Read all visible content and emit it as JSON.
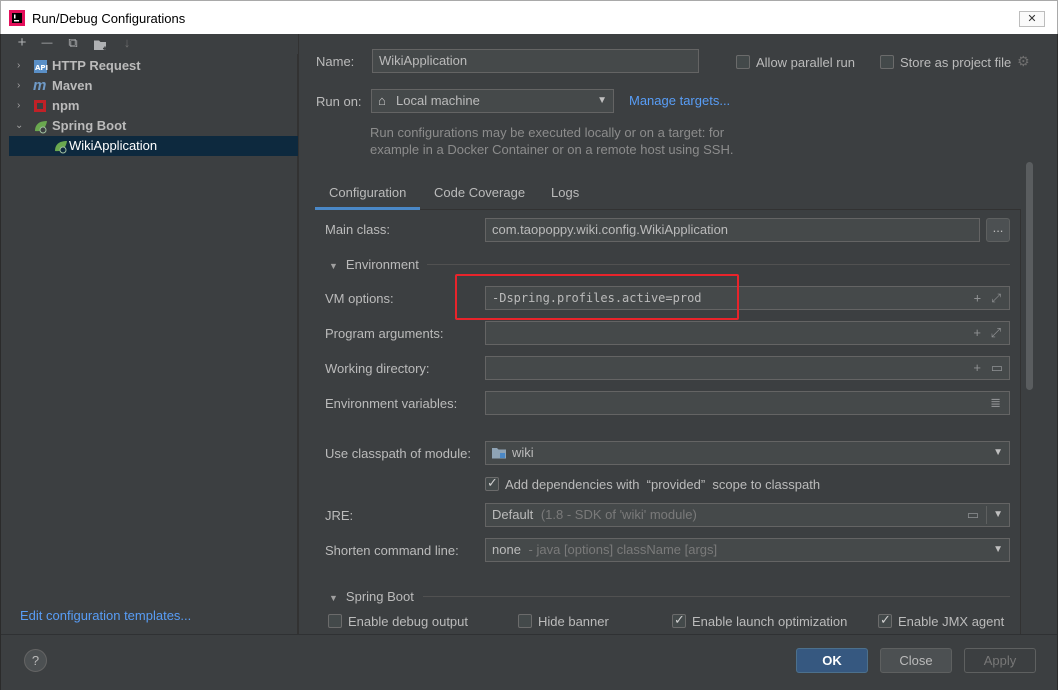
{
  "window": {
    "title": "Run/Debug Configurations",
    "close_glyph": "✕"
  },
  "toolbar": {
    "add": "+",
    "remove": "—",
    "copy": "⧉",
    "folder": "▾",
    "sort": "↓"
  },
  "tree": {
    "items": [
      {
        "label": "HTTP Request",
        "icon": "http-request-icon"
      },
      {
        "label": "Maven",
        "icon": "maven-icon"
      },
      {
        "label": "npm",
        "icon": "npm-icon"
      },
      {
        "label": "Spring Boot",
        "icon": "spring-boot-icon"
      },
      {
        "label": "WikiApplication",
        "icon": "spring-app-icon"
      }
    ],
    "arrows": {
      "collapsed": "›",
      "expanded": "⌄"
    }
  },
  "edit_templates": "Edit configuration templates...",
  "form": {
    "name_label": "Name:",
    "name_value": "WikiApplication",
    "allow_parallel": "Allow parallel run",
    "store_project": "Store as project file",
    "run_on_label": "Run on:",
    "run_on_value": "Local machine",
    "manage_targets": "Manage targets...",
    "hint_line1": "Run configurations may be executed locally or on a target: for",
    "hint_line2": "example in a Docker Container or on a remote host using SSH.",
    "tabs": [
      "Configuration",
      "Code Coverage",
      "Logs"
    ],
    "main_class_label": "Main class:",
    "main_class_value": "com.taopoppy.wiki.config.WikiApplication",
    "browse": "...",
    "environment_title": "Environment",
    "vm_options_label": "VM options:",
    "vm_options_value": "-Dspring.profiles.active=prod",
    "program_args_label": "Program arguments:",
    "working_dir_label": "Working directory:",
    "env_vars_label": "Environment variables:",
    "classpath_label": "Use classpath of module:",
    "classpath_value": "wiki",
    "add_deps": "Add dependencies with  “provided”  scope to classpath",
    "jre_label": "JRE:",
    "jre_value": "Default",
    "jre_hint": "(1.8 - SDK of 'wiki' module)",
    "shorten_label": "Shorten command line:",
    "shorten_value": "none",
    "shorten_hint": "- java [options] className [args]",
    "spring_boot_title": "Spring Boot",
    "enable_debug": "Enable debug output",
    "hide_banner": "Hide banner",
    "enable_launch": "Enable launch optimization",
    "enable_jmx": "Enable JMX agent"
  },
  "buttons": {
    "help": "?",
    "ok": "OK",
    "close": "Close",
    "apply": "Apply"
  }
}
